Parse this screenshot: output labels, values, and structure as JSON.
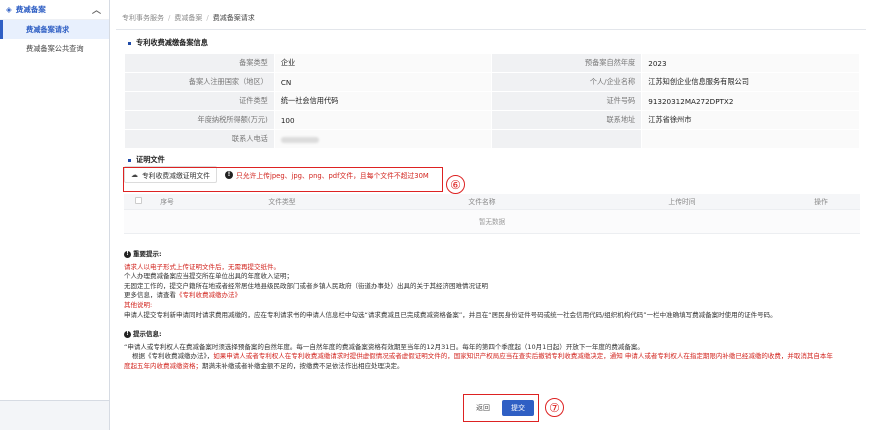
{
  "sidebar": {
    "group_label": "费减备案",
    "items": [
      {
        "label": "费减备案请求",
        "active": true
      },
      {
        "label": "费减备案公共查询",
        "active": false
      }
    ]
  },
  "breadcrumb": [
    "专利事务服务",
    "费减备案",
    "费减备案请求"
  ],
  "info_section": {
    "title": "专利收费减缴备案信息",
    "rows": [
      {
        "l1": "备案类型",
        "v1": "企业",
        "l2": "预备案自然年度",
        "v2": "2023"
      },
      {
        "l1": "备案人注册国家（地区）",
        "v1": "CN",
        "l2": "个人/企业名称",
        "v2": "江苏知创企业信息服务有限公司"
      },
      {
        "l1": "证件类型",
        "v1": "统一社会信用代码",
        "l2": "证件号码",
        "v2": "91320312MA272DPTX2"
      },
      {
        "l1": "年度纳税所得额(万元)",
        "v1": "100",
        "l2": "联系地址",
        "v2": "江苏省徐州市"
      },
      {
        "l1": "联系人电话",
        "v1": "",
        "l2": "",
        "v2": ""
      }
    ]
  },
  "docs_section": {
    "title": "证明文件",
    "upload_button": "专利收费减缴证明文件",
    "upload_hint": "只允许上传jpeg、jpg、png、pdf文件，且每个文件不超过30M",
    "columns": [
      "序号",
      "文件类型",
      "文件名称",
      "上传时间",
      "操作"
    ],
    "empty_text": "暂无数据"
  },
  "annotations": {
    "six": "⑥",
    "seven": "⑦"
  },
  "important": {
    "title": "重要提示:",
    "red_line": "请求人以电子形式上传证明文件后，无需再提交纸件。",
    "lines": [
      "个人办理费减备案应当提交所在单位出具的年度收入证明；",
      "无固定工作的，提交户籍所在地或者经常居住地县级民政部门或者乡镇人民政府（街道办事处）出具的关于其经济困难情况证明",
      "更多信息，请查看"
    ],
    "link": "《专利收费减缴办法》",
    "other_label": "其他说明:",
    "other_text": "申请人提交专利新申请同时请求费用减缴的，应在专利请求书的申请人信息栏中勾选“请求费减且已完成费减资格备案”，并且在“居民身份证件号码或统一社会信用代码/组织机构代码”一栏中准确填写费减备案时使用的证件号码。"
  },
  "tips": {
    "title": "提示信息:",
    "line1": "“申请人或专利权人在费减备案时须选择预备案的自然年度。每一自然年度的费减备案资格有效期至当年的12月31日。每年的第四个季度起（10月1日起）开放下一年度的费减备案。",
    "line2_a": "根据《专利收费减缴办法》，",
    "line2_red": "如果申请人或者专利权人在专利收费减缴请求时提供虚假情况或者虚假证明文件的，国家知识产权局应当在查实后撤销专利收费减缴决定，通知 申请人或者专利权人在指定期限内补缴已经减缴的收费，并取消其自本年",
    "line3_red": "度起五年内收费减缴资格；",
    "line3_b": "期满未补缴或者补缴金额不足的，按缴费不足依法作出相应处理决定。"
  },
  "footer": {
    "back": "返回",
    "submit": "提交"
  }
}
